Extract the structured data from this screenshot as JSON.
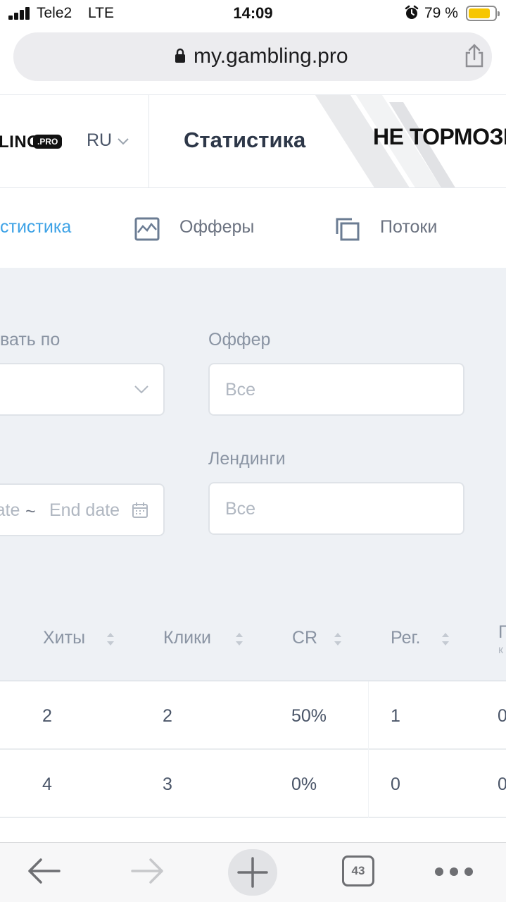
{
  "status_bar": {
    "carrier": "Tele2",
    "network": "LTE",
    "time": "14:09",
    "battery_percent": "79 %",
    "battery_color": "#f7c600"
  },
  "browser": {
    "url": "my.gambling.pro",
    "lock_icon": "lock-icon",
    "share_icon": "share-icon"
  },
  "header": {
    "logo_text": "LING",
    "logo_badge": ".PRO",
    "language": "RU",
    "title": "Статистика",
    "promo_text": "НЕ ТОРМОЗИ"
  },
  "tabs": [
    {
      "label": "стистика",
      "icon": "",
      "active": true
    },
    {
      "label": "Офферы",
      "icon": "chart-icon",
      "active": false
    },
    {
      "label": "Потоки",
      "icon": "copy-icon",
      "active": false
    }
  ],
  "accent_color": "#3da2e6",
  "filters": {
    "group_by_label": "вать по",
    "group_by_value": "",
    "offer_label": "Оффер",
    "offer_placeholder": "Все",
    "date_start_placeholder": "Start date",
    "date_separator": "~",
    "date_end_placeholder": "End date",
    "landings_label": "Лендинги",
    "landings_placeholder": "Все"
  },
  "table": {
    "columns": [
      "Хиты",
      "Клики",
      "CR",
      "Рег.",
      "П"
    ],
    "last_column_sub": "к",
    "rows": [
      [
        "2",
        "2",
        "50%",
        "1",
        "0"
      ],
      [
        "4",
        "3",
        "0%",
        "0",
        "0"
      ]
    ]
  },
  "toolbar": {
    "open_tabs": "43"
  }
}
